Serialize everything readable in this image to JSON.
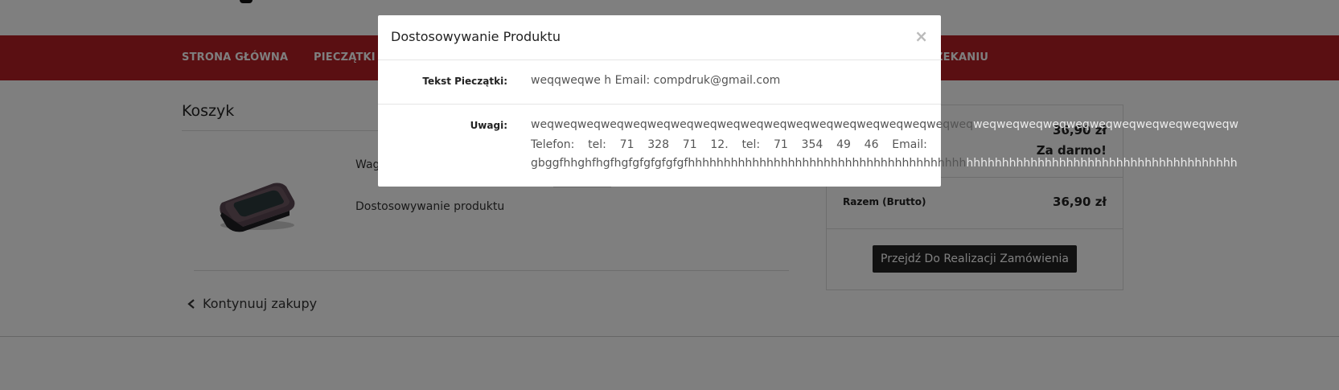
{
  "nav": {
    "items": [
      {
        "label": "STRONA GŁÓWNA"
      },
      {
        "label": "PIECZĄTKI"
      },
      {
        "label": "ZEKANIU"
      }
    ]
  },
  "cart": {
    "title": "Koszyk",
    "product_name": "Wag",
    "customize_label": "Dostosowywanie produktu",
    "continue_label": "Kontynuuj zakupy"
  },
  "summary": {
    "price": "36,90 zł",
    "shipping": "Za darmo!",
    "total_label": "Razem (Brutto)",
    "total_value": "36,90 zł",
    "checkout_label": "Przejdź Do Realizacji Zamówienia"
  },
  "modal": {
    "title": "Dostosowywanie Produktu",
    "close": "×",
    "stamp_label": "Tekst Pieczątki:",
    "stamp_value": "weqqweqwe h Email: compdruk@gmail.com",
    "notes_label": "Uwagi:",
    "notes_line1_in": "weqweqweqweqweqweqweqweqweqweqweqweqweqweqweqweqweqweqweq",
    "notes_line1_out": "weqweqweqweqweqweqweqweqweqweqweqw",
    "notes_phone_words": [
      "Telefon:",
      "tel:",
      "71",
      "328",
      "71",
      "12.",
      "tel:",
      "71",
      "354",
      "49",
      "46",
      "Email:"
    ],
    "notes_line3_in": "gbggfhhghfhgfhgfgfgfgfgfgfhhhhhhhhhhhhhhhhhhhhhhhhhhhhhhhhhhhhhhh",
    "notes_line3_out": "hhhhhhhhhhhhhhhhhhhhhhhhhhhhhhhhhhhhhh"
  }
}
